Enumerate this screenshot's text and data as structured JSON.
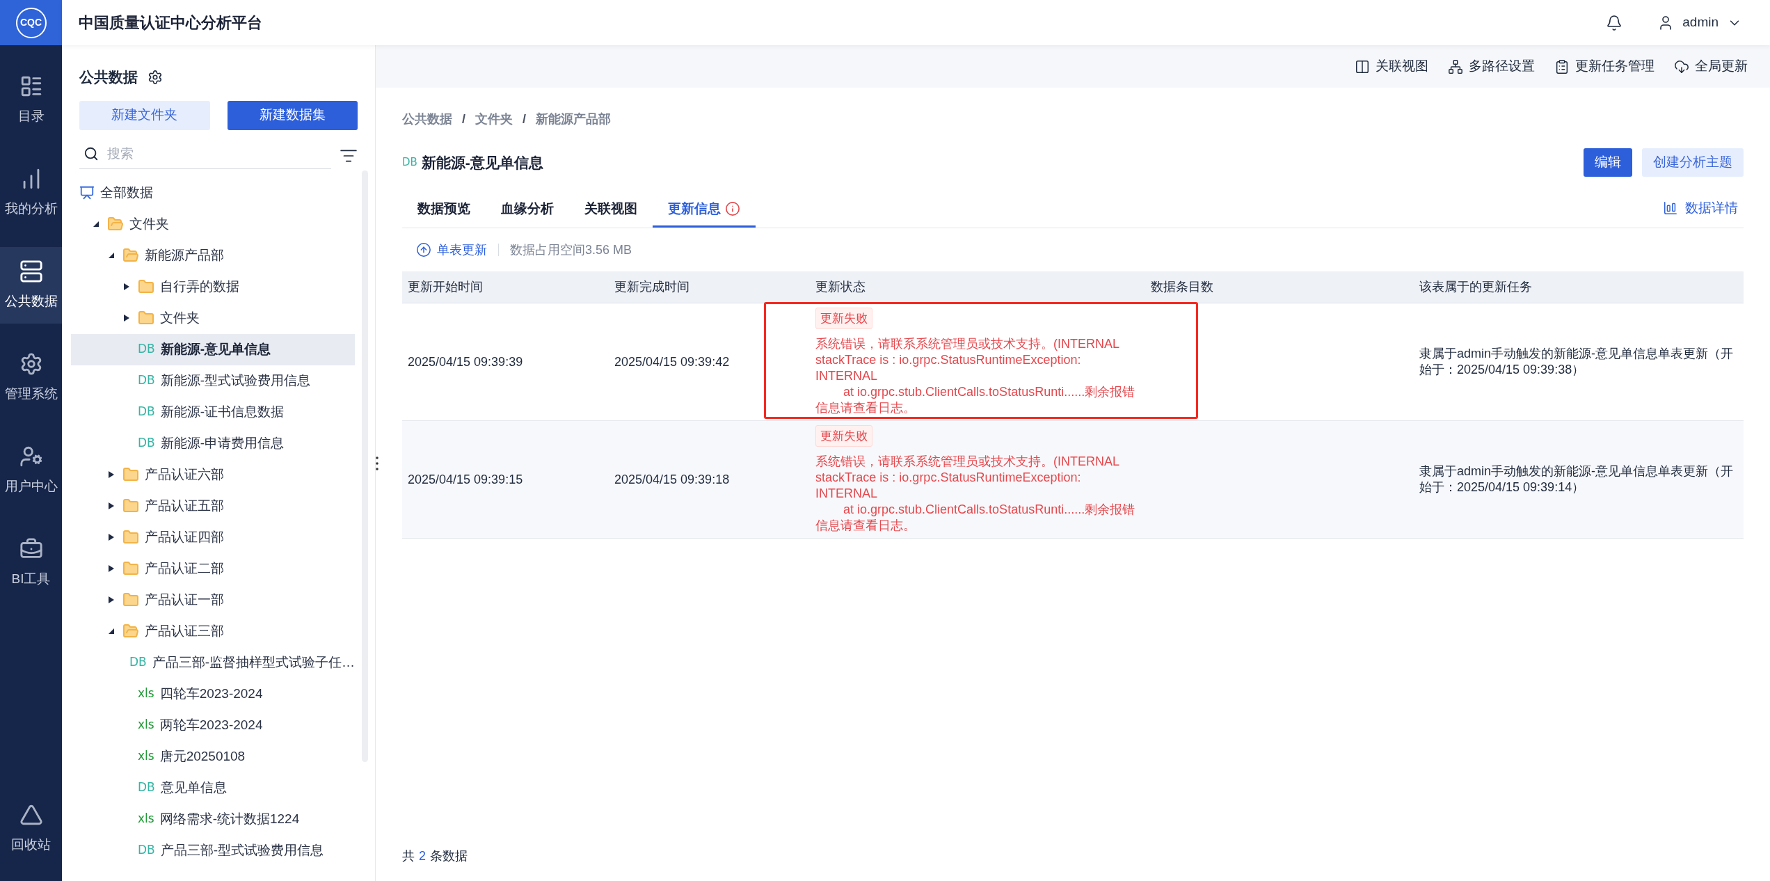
{
  "app": {
    "logo": "CQC",
    "title": "中国质量认证中心分析平台",
    "user": "admin"
  },
  "nav": [
    {
      "label": "目录",
      "selected": false
    },
    {
      "label": "我的分析",
      "selected": false
    },
    {
      "label": "公共数据",
      "selected": true
    },
    {
      "label": "管理系统",
      "selected": false
    },
    {
      "label": "用户中心",
      "selected": false
    },
    {
      "label": "BI工具",
      "selected": false
    },
    {
      "label": "回收站",
      "selected": false
    }
  ],
  "panel": {
    "title": "公共数据",
    "buttons": [
      {
        "label": "新建文件夹",
        "kind": "secondary"
      },
      {
        "label": "新建数据集",
        "kind": "primary"
      }
    ],
    "search": {
      "placeholder": "搜索"
    },
    "tree": [
      {
        "label": "全部数据",
        "kind": "root",
        "selected": false,
        "children": [
          {
            "label": "文件夹",
            "kind": "folder",
            "expanded": true,
            "selected": false,
            "children": [
              {
                "label": "新能源产品部",
                "kind": "folder",
                "expanded": true,
                "selected": false,
                "children": [
                  {
                    "label": "自行弄的数据",
                    "kind": "folder",
                    "expanded": false,
                    "selected": false
                  },
                  {
                    "label": "文件夹",
                    "kind": "folder",
                    "expanded": false,
                    "selected": false
                  },
                  {
                    "label": "新能源-意见单信息",
                    "kind": "db",
                    "tag": "DB",
                    "selected": true
                  },
                  {
                    "label": "新能源-型式试验费用信息",
                    "kind": "db",
                    "tag": "DB",
                    "selected": false
                  },
                  {
                    "label": "新能源-证书信息数据",
                    "kind": "db",
                    "tag": "DB",
                    "selected": false
                  },
                  {
                    "label": "新能源-申请费用信息",
                    "kind": "db",
                    "tag": "DB",
                    "selected": false
                  }
                ]
              },
              {
                "label": "产品认证六部",
                "kind": "folder",
                "expanded": false,
                "selected": false
              },
              {
                "label": "产品认证五部",
                "kind": "folder",
                "expanded": false,
                "selected": false
              },
              {
                "label": "产品认证四部",
                "kind": "folder",
                "expanded": false,
                "selected": false
              },
              {
                "label": "产品认证二部",
                "kind": "folder",
                "expanded": false,
                "selected": false
              },
              {
                "label": "产品认证一部",
                "kind": "folder",
                "expanded": false,
                "selected": false
              },
              {
                "label": "产品认证三部",
                "kind": "folder",
                "expanded": true,
                "selected": false,
                "children": [
                  {
                    "label": "产品三部-监督抽样型式试验子任…",
                    "kind": "db",
                    "tag": "DB",
                    "selected": false
                  },
                  {
                    "label": "四轮车2023-2024",
                    "kind": "xls",
                    "tag": "xls",
                    "selected": false
                  },
                  {
                    "label": "两轮车2023-2024",
                    "kind": "xls",
                    "tag": "xls",
                    "selected": false
                  },
                  {
                    "label": "唐元20250108",
                    "kind": "xls",
                    "tag": "xls",
                    "selected": false
                  },
                  {
                    "label": "意见单信息",
                    "kind": "db",
                    "tag": "DB",
                    "selected": false
                  },
                  {
                    "label": "网络需求-统计数据1224",
                    "kind": "xls",
                    "tag": "xls",
                    "selected": false
                  },
                  {
                    "label": "产品三部-型式试验费用信息",
                    "kind": "db",
                    "tag": "DB",
                    "selected": false
                  }
                ]
              }
            ]
          }
        ]
      }
    ]
  },
  "toolbar": [
    "关联视图",
    "多路径设置",
    "更新任务管理",
    "全局更新"
  ],
  "breadcrumb": {
    "separator": "/",
    "items": [
      "公共数据",
      "文件夹",
      "新能源产品部"
    ]
  },
  "dataset": {
    "tag": "DB",
    "title": "新能源-意见单信息",
    "actions": [
      {
        "label": "编辑",
        "kind": "primary"
      },
      {
        "label": "创建分析主题",
        "kind": "secondary"
      }
    ]
  },
  "tabs": [
    {
      "label": "数据预览",
      "selected": false,
      "alert": false
    },
    {
      "label": "血缘分析",
      "selected": false,
      "alert": false
    },
    {
      "label": "关联视图",
      "selected": false,
      "alert": false
    },
    {
      "label": "更新信息",
      "selected": true,
      "alert": true
    }
  ],
  "details_link": "数据详情",
  "subbar": {
    "refresh": "单表更新",
    "storage": "数据占用空间3.56 MB"
  },
  "table": {
    "columns": [
      "更新开始时间",
      "更新完成时间",
      "更新状态",
      "数据条目数",
      "该表属于的更新任务"
    ],
    "rows": [
      {
        "start": "2025/04/15 09:39:39",
        "end": "2025/04/15 09:39:42",
        "status": {
          "failed": true,
          "label": "更新失败",
          "message": "系统错误，请联系系统管理员或技术支持。(INTERNAL stackTrace is : io.grpc.StatusRuntimeException: INTERNAL\n        at io.grpc.stub.ClientCalls.toStatusRunti......剩余报错信息请查看日志。"
        },
        "task": "隶属于admin手动触发的新能源-意见单信息单表更新（开始于：2025/04/15 09:39:38）",
        "highlighted": true
      },
      {
        "start": "2025/04/15 09:39:15",
        "end": "2025/04/15 09:39:18",
        "status": {
          "failed": true,
          "label": "更新失败",
          "message": "系统错误，请联系系统管理员或技术支持。(INTERNAL stackTrace is : io.grpc.StatusRuntimeException: INTERNAL\n        at io.grpc.stub.ClientCalls.toStatusRunti......剩余报错信息请查看日志。"
        },
        "task": "隶属于admin手动触发的新能源-意见单信息单表更新（开始于：2025/04/15 09:39:14）",
        "highlighted": false
      }
    ]
  },
  "footer": {
    "prefix": "共",
    "count": "2",
    "suffix": "条数据"
  }
}
